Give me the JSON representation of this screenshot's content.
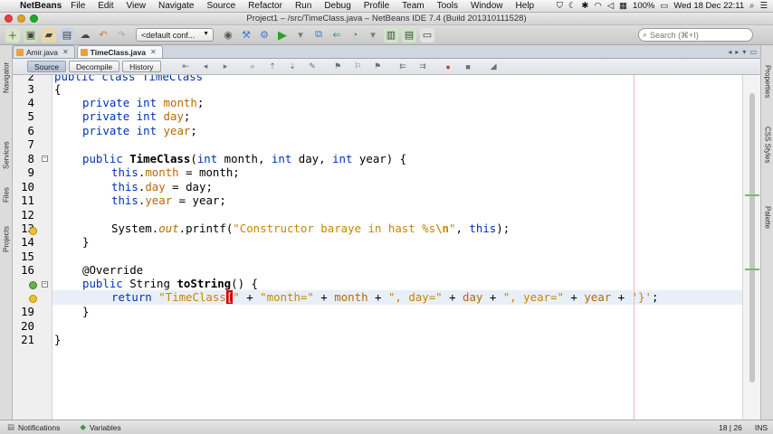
{
  "menubar": {
    "app": "NetBeans",
    "items": [
      "File",
      "Edit",
      "View",
      "Navigate",
      "Source",
      "Refactor",
      "Run",
      "Debug",
      "Profile",
      "Team",
      "Tools",
      "Window",
      "Help"
    ],
    "battery": "100%",
    "datetime": "Wed 18 Dec  22:11"
  },
  "window": {
    "title": "Project1 – /src/TimeClass.java – NetBeans IDE 7.4 (Build 201310111528)"
  },
  "toolbar": {
    "config": "<default conf...",
    "search_placeholder": "Search (⌘+I)"
  },
  "left_panels": [
    "Navigator",
    "Services",
    "Files",
    "Projects"
  ],
  "right_panels": [
    "Properties",
    "CSS Styles",
    "Palette"
  ],
  "file_tabs": [
    {
      "label": "Amir.java",
      "active": false
    },
    {
      "label": "TimeClass.java",
      "active": true
    }
  ],
  "editor_views": [
    "Source",
    "Decompile",
    "History"
  ],
  "code": {
    "line_numbers": [
      "2",
      "3",
      "4",
      "5",
      "6",
      "7",
      "8",
      "9",
      "10",
      "11",
      "12",
      "13",
      "14",
      "15",
      "16",
      "",
      "",
      "19",
      "20",
      "21"
    ],
    "partial_top": "public class TimeClass",
    "l3": "{",
    "l4_kw": "private int ",
    "l4_f": "month",
    "l4_e": ";",
    "l5_kw": "private int ",
    "l5_f": "day",
    "l5_e": ";",
    "l6_kw": "private int ",
    "l6_f": "year",
    "l6_e": ";",
    "l8_a": "public ",
    "l8_b": "TimeClass",
    "l8_c": "(",
    "l8_d": "int",
    "l8_e": " month, ",
    "l8_f": "int",
    "l8_g": " day, ",
    "l8_h": "int",
    "l8_i": " year) {",
    "l9_a": "this",
    "l9_b": ".",
    "l9_c": "month",
    "l9_d": " = month;",
    "l10_a": "this",
    "l10_b": ".",
    "l10_c": "day",
    "l10_d": " = day;",
    "l11_a": "this",
    "l11_b": ".",
    "l11_c": "year",
    "l11_d": " = year;",
    "l13_a": "System.",
    "l13_b": "out",
    "l13_c": ".printf(",
    "l13_d": "\"Constructor baraye in hast %s",
    "l13_e": "\\n",
    "l13_f": "\"",
    "l13_g": ", ",
    "l13_h": "this",
    "l13_i": ");",
    "l14": "}",
    "l16": "@Override",
    "l17_a": "public ",
    "l17_b": "String ",
    "l17_c": "toString",
    "l17_d": "() {",
    "l18_a": "return ",
    "l18_b": "\"TimeClass",
    "l18_c": "[",
    "l18_d": "\"",
    "l18_e": " + ",
    "l18_f": "\"month=\"",
    "l18_g": " + ",
    "l18_h": "month",
    "l18_i": " + ",
    "l18_j": "\", day=\"",
    "l18_k": " + ",
    "l18_l": "day",
    "l18_m": " + ",
    "l18_n": "\", year=\"",
    "l18_o": " + ",
    "l18_p": "year",
    "l18_q": " + ",
    "l18_r": "'}'",
    "l18_s": ";",
    "l19": "}",
    "l21": "}"
  },
  "status": {
    "notifications": "Notifications",
    "variables": "Variables",
    "position": "18 | 26",
    "mode": "INS"
  }
}
